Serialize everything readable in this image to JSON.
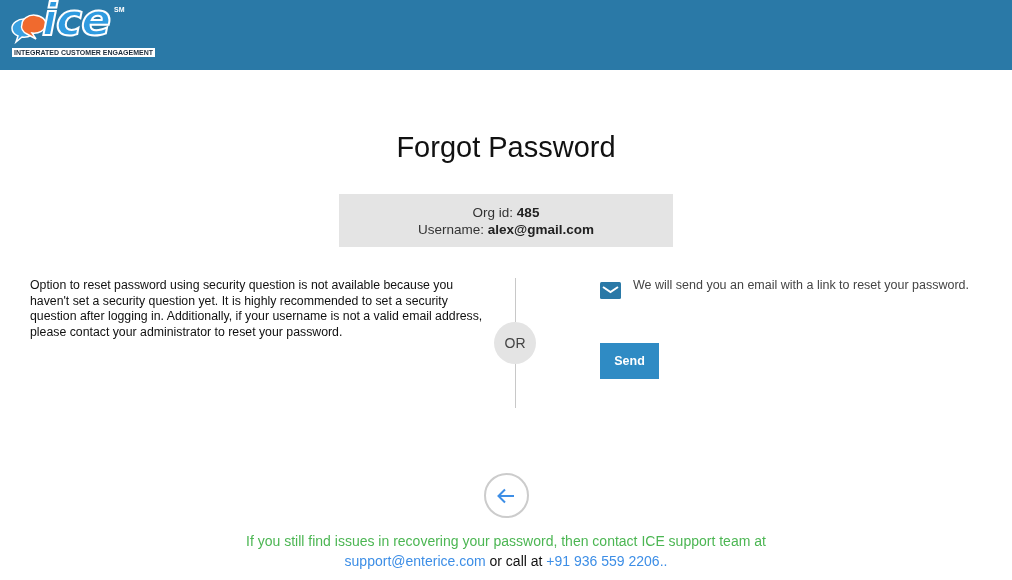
{
  "header": {
    "logo": {
      "wordmark": "ice",
      "mark": "SM",
      "tagline": "INTEGRATED CUSTOMER ENGAGEMENT"
    }
  },
  "title": "Forgot Password",
  "account": {
    "org": "Org id: **485**",
    "username": "Username: **alex@gmail.com**"
  },
  "security_note": "Option to reset password using security question is not available because you haven't set a security question yet. It is highly recommended to set a security question after logging in. Additionally, if your username is not a valid email address, please contact your administrator to reset your password.",
  "divider_label": "OR",
  "email_option": {
    "text": "We will send you an email with a link to reset your password.",
    "button": "Send"
  },
  "footer": {
    "text": "If you still find issues in recovering your password, then contact ICE support team at",
    "email": "support@enterice.com",
    "middle": "or call at",
    "phone": "+91 936 559 2206",
    "end": ".."
  }
}
